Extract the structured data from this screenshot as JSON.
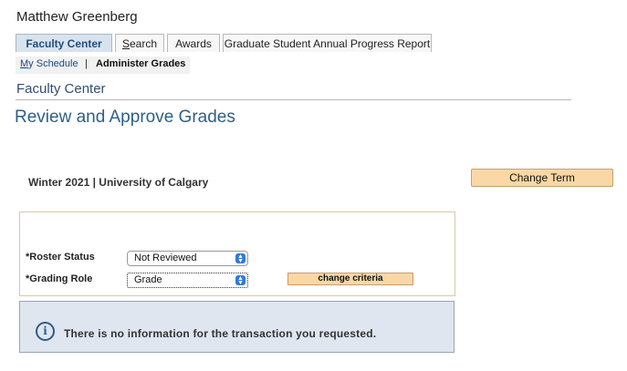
{
  "user": {
    "name": "Matthew Greenberg"
  },
  "tabs": [
    {
      "label": "Faculty Center",
      "active": true
    },
    {
      "label": "Search",
      "accesskey": "S"
    },
    {
      "label": "Awards"
    },
    {
      "label": "Graduate Student Annual Progress Report"
    }
  ],
  "subnav": {
    "link_access": "M",
    "link_rest": "y Schedule",
    "separator": "|",
    "current": "Administer Grades"
  },
  "section": {
    "title": "Faculty Center"
  },
  "page": {
    "title": "Review and Approve Grades"
  },
  "term": {
    "text": "Winter 2021 | University of Calgary",
    "change_term_label": "Change Term"
  },
  "criteria": {
    "roster_status_label": "*Roster Status",
    "roster_status_value": "Not Reviewed",
    "grading_role_label": "*Grading Role",
    "grading_role_value": "Grade",
    "change_criteria_label": "change criteria"
  },
  "message": {
    "icon": "info-icon",
    "text": "There is no information for the transaction you requested."
  },
  "colors": {
    "button_bg": "#f9d7a6",
    "active_tab_bg": "#d8e3ef",
    "info_bg": "#e0e6ef",
    "title_blue": "#2f5f85"
  }
}
